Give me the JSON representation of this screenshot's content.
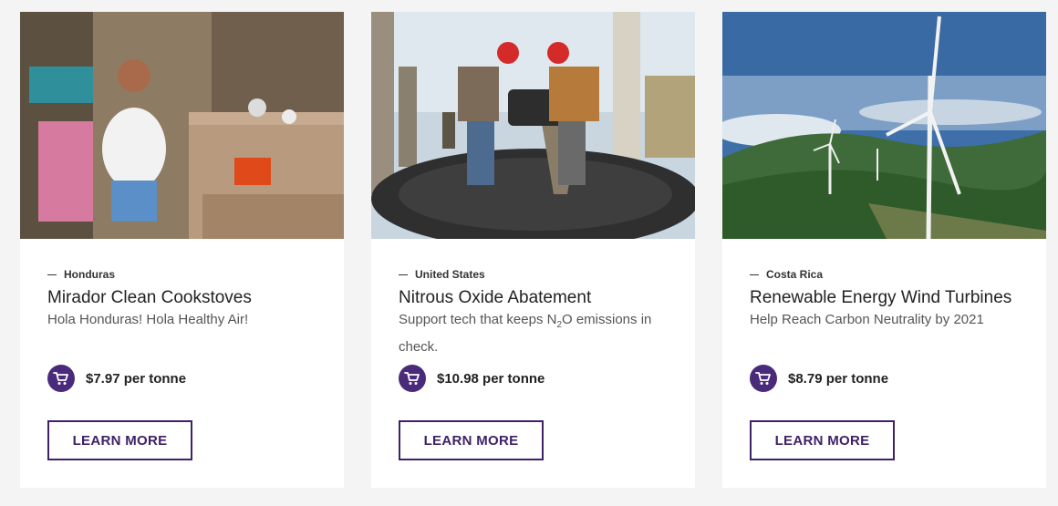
{
  "projects": [
    {
      "country": "Honduras",
      "title": "Mirador Clean Cookstoves",
      "subtitle": "Hola Honduras! Hola Healthy Air!",
      "price": "$7.97 per tonne",
      "button_label": "LEARN MORE",
      "photo_icon": "cookstove-photo"
    },
    {
      "country": "United States",
      "title": "Nitrous Oxide Abatement",
      "subtitle_prefix": "Support tech that keeps N",
      "subtitle_sub": "2",
      "subtitle_suffix": "O emissions in check.",
      "price": "$10.98 per tonne",
      "button_label": "LEARN MORE",
      "photo_icon": "industrial-workers-photo"
    },
    {
      "country": "Costa Rica",
      "title": "Renewable Energy Wind Turbines",
      "subtitle": "Help Reach Carbon Neutrality by 2021",
      "price": "$8.79 per tonne",
      "button_label": "LEARN MORE",
      "photo_icon": "wind-turbine-photo"
    }
  ],
  "colors": {
    "accent": "#3f2167",
    "cart_bg": "#4a2a7a",
    "page_bg": "#f4f4f4"
  }
}
